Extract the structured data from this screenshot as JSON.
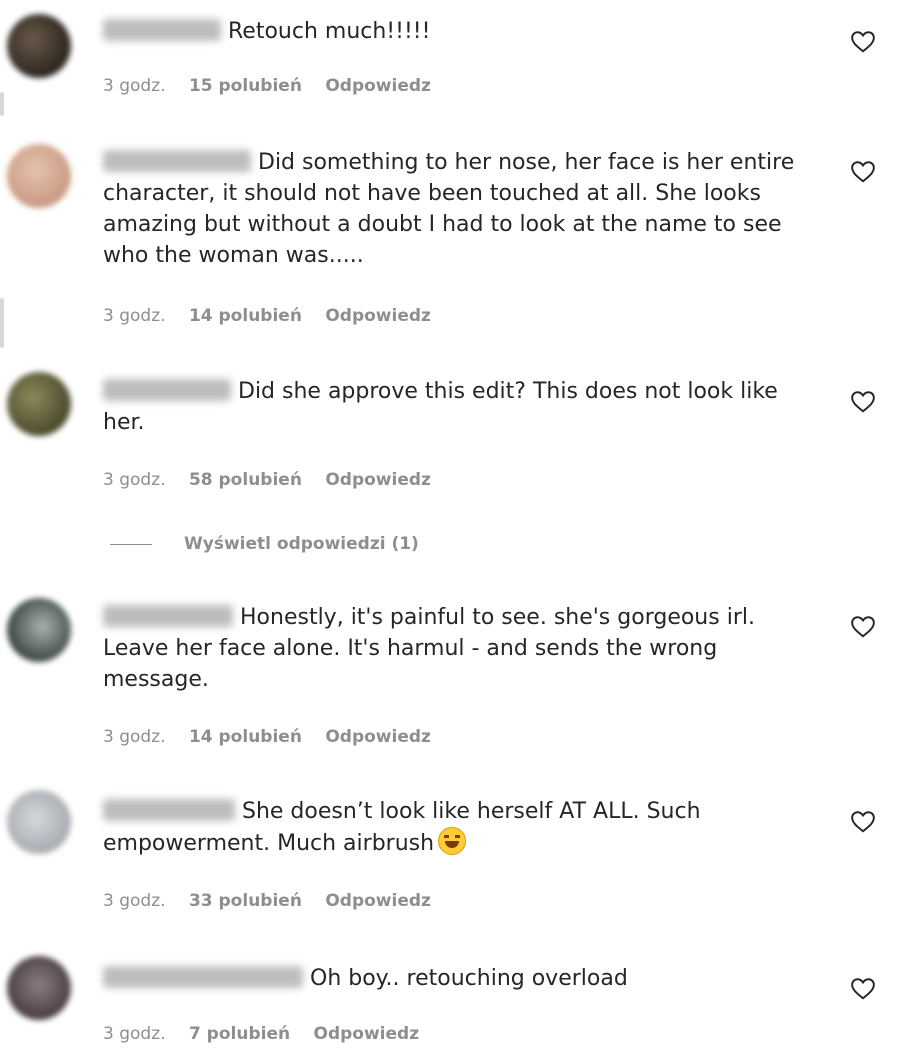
{
  "comments": [
    {
      "text": "Retouch much!!!!!",
      "time": "3 godz.",
      "likes": "15 polubień",
      "reply": "Odpowiedz"
    },
    {
      "text": "Did something to her nose, her face is her entire character, it should not have been touched at all. She looks amazing but without a doubt I had to look at the name to see who the woman was.....",
      "time": "3 godz.",
      "likes": "14 polubień",
      "reply": "Odpowiedz"
    },
    {
      "text": "Did she approve this edit? This does not look like her.",
      "time": "3 godz.",
      "likes": "58 polubień",
      "reply": "Odpowiedz",
      "view_replies": "Wyświetl odpowiedzi (1)"
    },
    {
      "text": "Honestly, it's painful to see. she's gorgeous irl. Leave her face alone. It's harmul - and sends the wrong message.",
      "time": "3 godz.",
      "likes": "14 polubień",
      "reply": "Odpowiedz"
    },
    {
      "text": "She doesn’t look like herself AT ALL. Such empowerment. Much airbrush",
      "time": "3 godz.",
      "likes": "33 polubień",
      "reply": "Odpowiedz"
    },
    {
      "text": "Oh boy.. retouching overload",
      "time": "3 godz.",
      "likes": "7 polubień",
      "reply": "Odpowiedz"
    }
  ],
  "colors": {
    "text": "#262626",
    "meta": "#8e8e8e"
  },
  "icons": {
    "like": "heart-outline-icon",
    "emoji": "laughing-tears-emoji-icon"
  }
}
